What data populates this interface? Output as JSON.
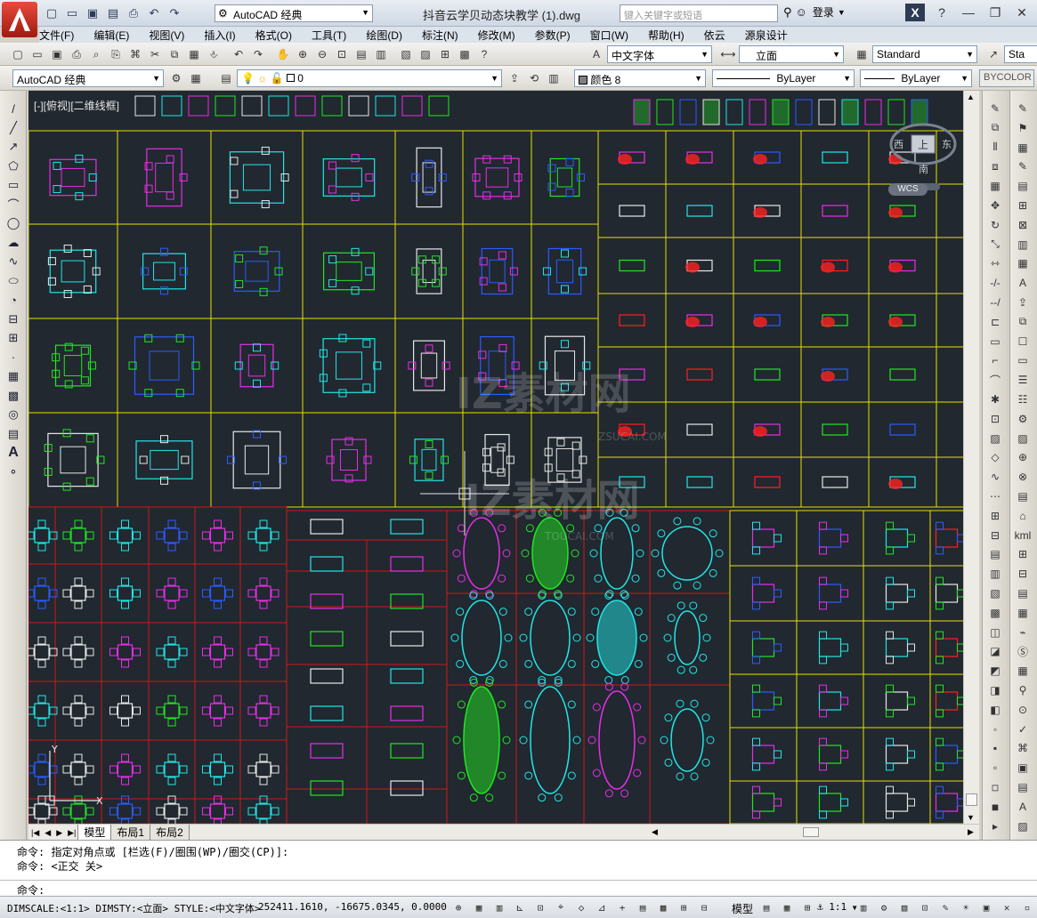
{
  "window": {
    "title": "抖音云学贝动态块教学 (1).dwg",
    "workspace": "AutoCAD 经典",
    "search_placeholder": "键入关键字或短语",
    "login": "登录"
  },
  "menu": [
    "文件(F)",
    "编辑(E)",
    "视图(V)",
    "插入(I)",
    "格式(O)",
    "工具(T)",
    "绘图(D)",
    "标注(N)",
    "修改(M)",
    "参数(P)",
    "窗口(W)",
    "帮助(H)",
    "依云",
    "源泉设计"
  ],
  "toolbar1": {
    "text_style": "中文字体",
    "dim_style": "立面",
    "table_style": "Standard",
    "extra": "Sta"
  },
  "toolbar2": {
    "workspace": "AutoCAD 经典",
    "layer": "0",
    "color": "颜色 8",
    "linetype": "ByLayer",
    "lineweight": "ByLayer",
    "plotstyle": "BYCOLOR"
  },
  "viewport": {
    "label": "[-][俯视][二维线框]",
    "viewcube": {
      "top": "上",
      "west": "西",
      "east": "东",
      "south": "南",
      "wcs": "WCS"
    }
  },
  "watermark": {
    "main": "IZ素材网",
    "url1": "ZSUCAI.COM",
    "url2": "TOUCAI.COM"
  },
  "tabs": [
    "模型",
    "布局1",
    "布局2"
  ],
  "command": {
    "line1": "命令: 指定对角点或 [栏选(F)/圈围(WP)/圈交(CP)]:",
    "line2": "命令:  <正交 关>",
    "prompt": "命令:"
  },
  "status": {
    "text": "DIMSCALE:<1:1> DIMSTY:<立面> STYLE:<中文字体>",
    "coords": "252411.1610, -16675.0345, 0.0000",
    "model": "模型",
    "scale": "1:1"
  },
  "colors": {
    "canvas_bg": "#212830",
    "grid_yellow": "#e6e000",
    "grid_red": "#d01818",
    "white": "#e8e8e8",
    "cyan": "#22e6e6",
    "magenta": "#e62ee6",
    "green": "#22e622",
    "blue": "#2b5cff",
    "red": "#ff2020"
  }
}
